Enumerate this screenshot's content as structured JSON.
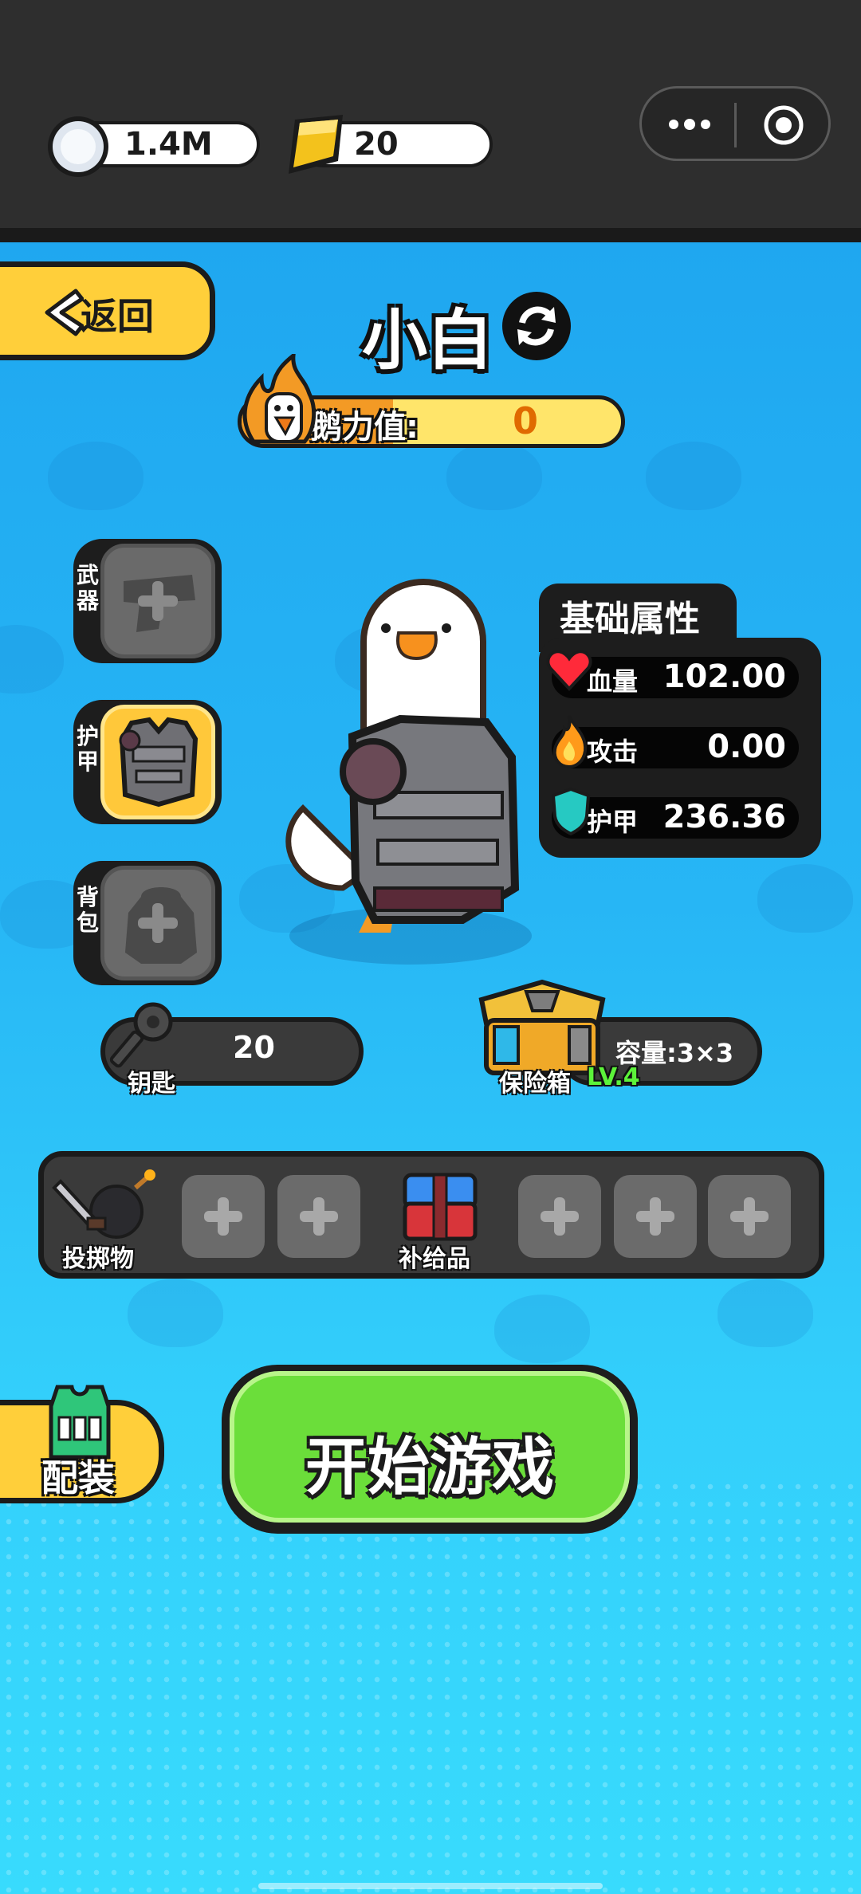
{
  "currency": {
    "silver": "1.4M",
    "gold": "20"
  },
  "header": {
    "back_label": "返回",
    "character_name": "小白",
    "power_label": "鹅力值:",
    "power_value": "0"
  },
  "equipment_slots": [
    {
      "label": "武器",
      "state": "empty"
    },
    {
      "label": "护甲",
      "state": "equipped"
    },
    {
      "label": "背包",
      "state": "empty"
    }
  ],
  "stats": {
    "title": "基础属性",
    "rows": [
      {
        "name": "血量",
        "value": "102.00",
        "icon": "heart-icon"
      },
      {
        "name": "攻击",
        "value": "0.00",
        "icon": "flame-icon"
      },
      {
        "name": "护甲",
        "value": "236.36",
        "icon": "shield-icon"
      }
    ]
  },
  "keys": {
    "label": "钥匙",
    "value": "20"
  },
  "safe": {
    "label": "保险箱",
    "level": "LV.4",
    "capacity": "容量:3×3"
  },
  "loadout": {
    "throwable_label": "投掷物",
    "supply_label": "补给品"
  },
  "buttons": {
    "loadout_label": "配装",
    "start_label": "开始游戏"
  },
  "colors": {
    "accent_yellow": "#ffcf3a",
    "start_green": "#6bde3a",
    "background_blue": "#27b6f5"
  }
}
